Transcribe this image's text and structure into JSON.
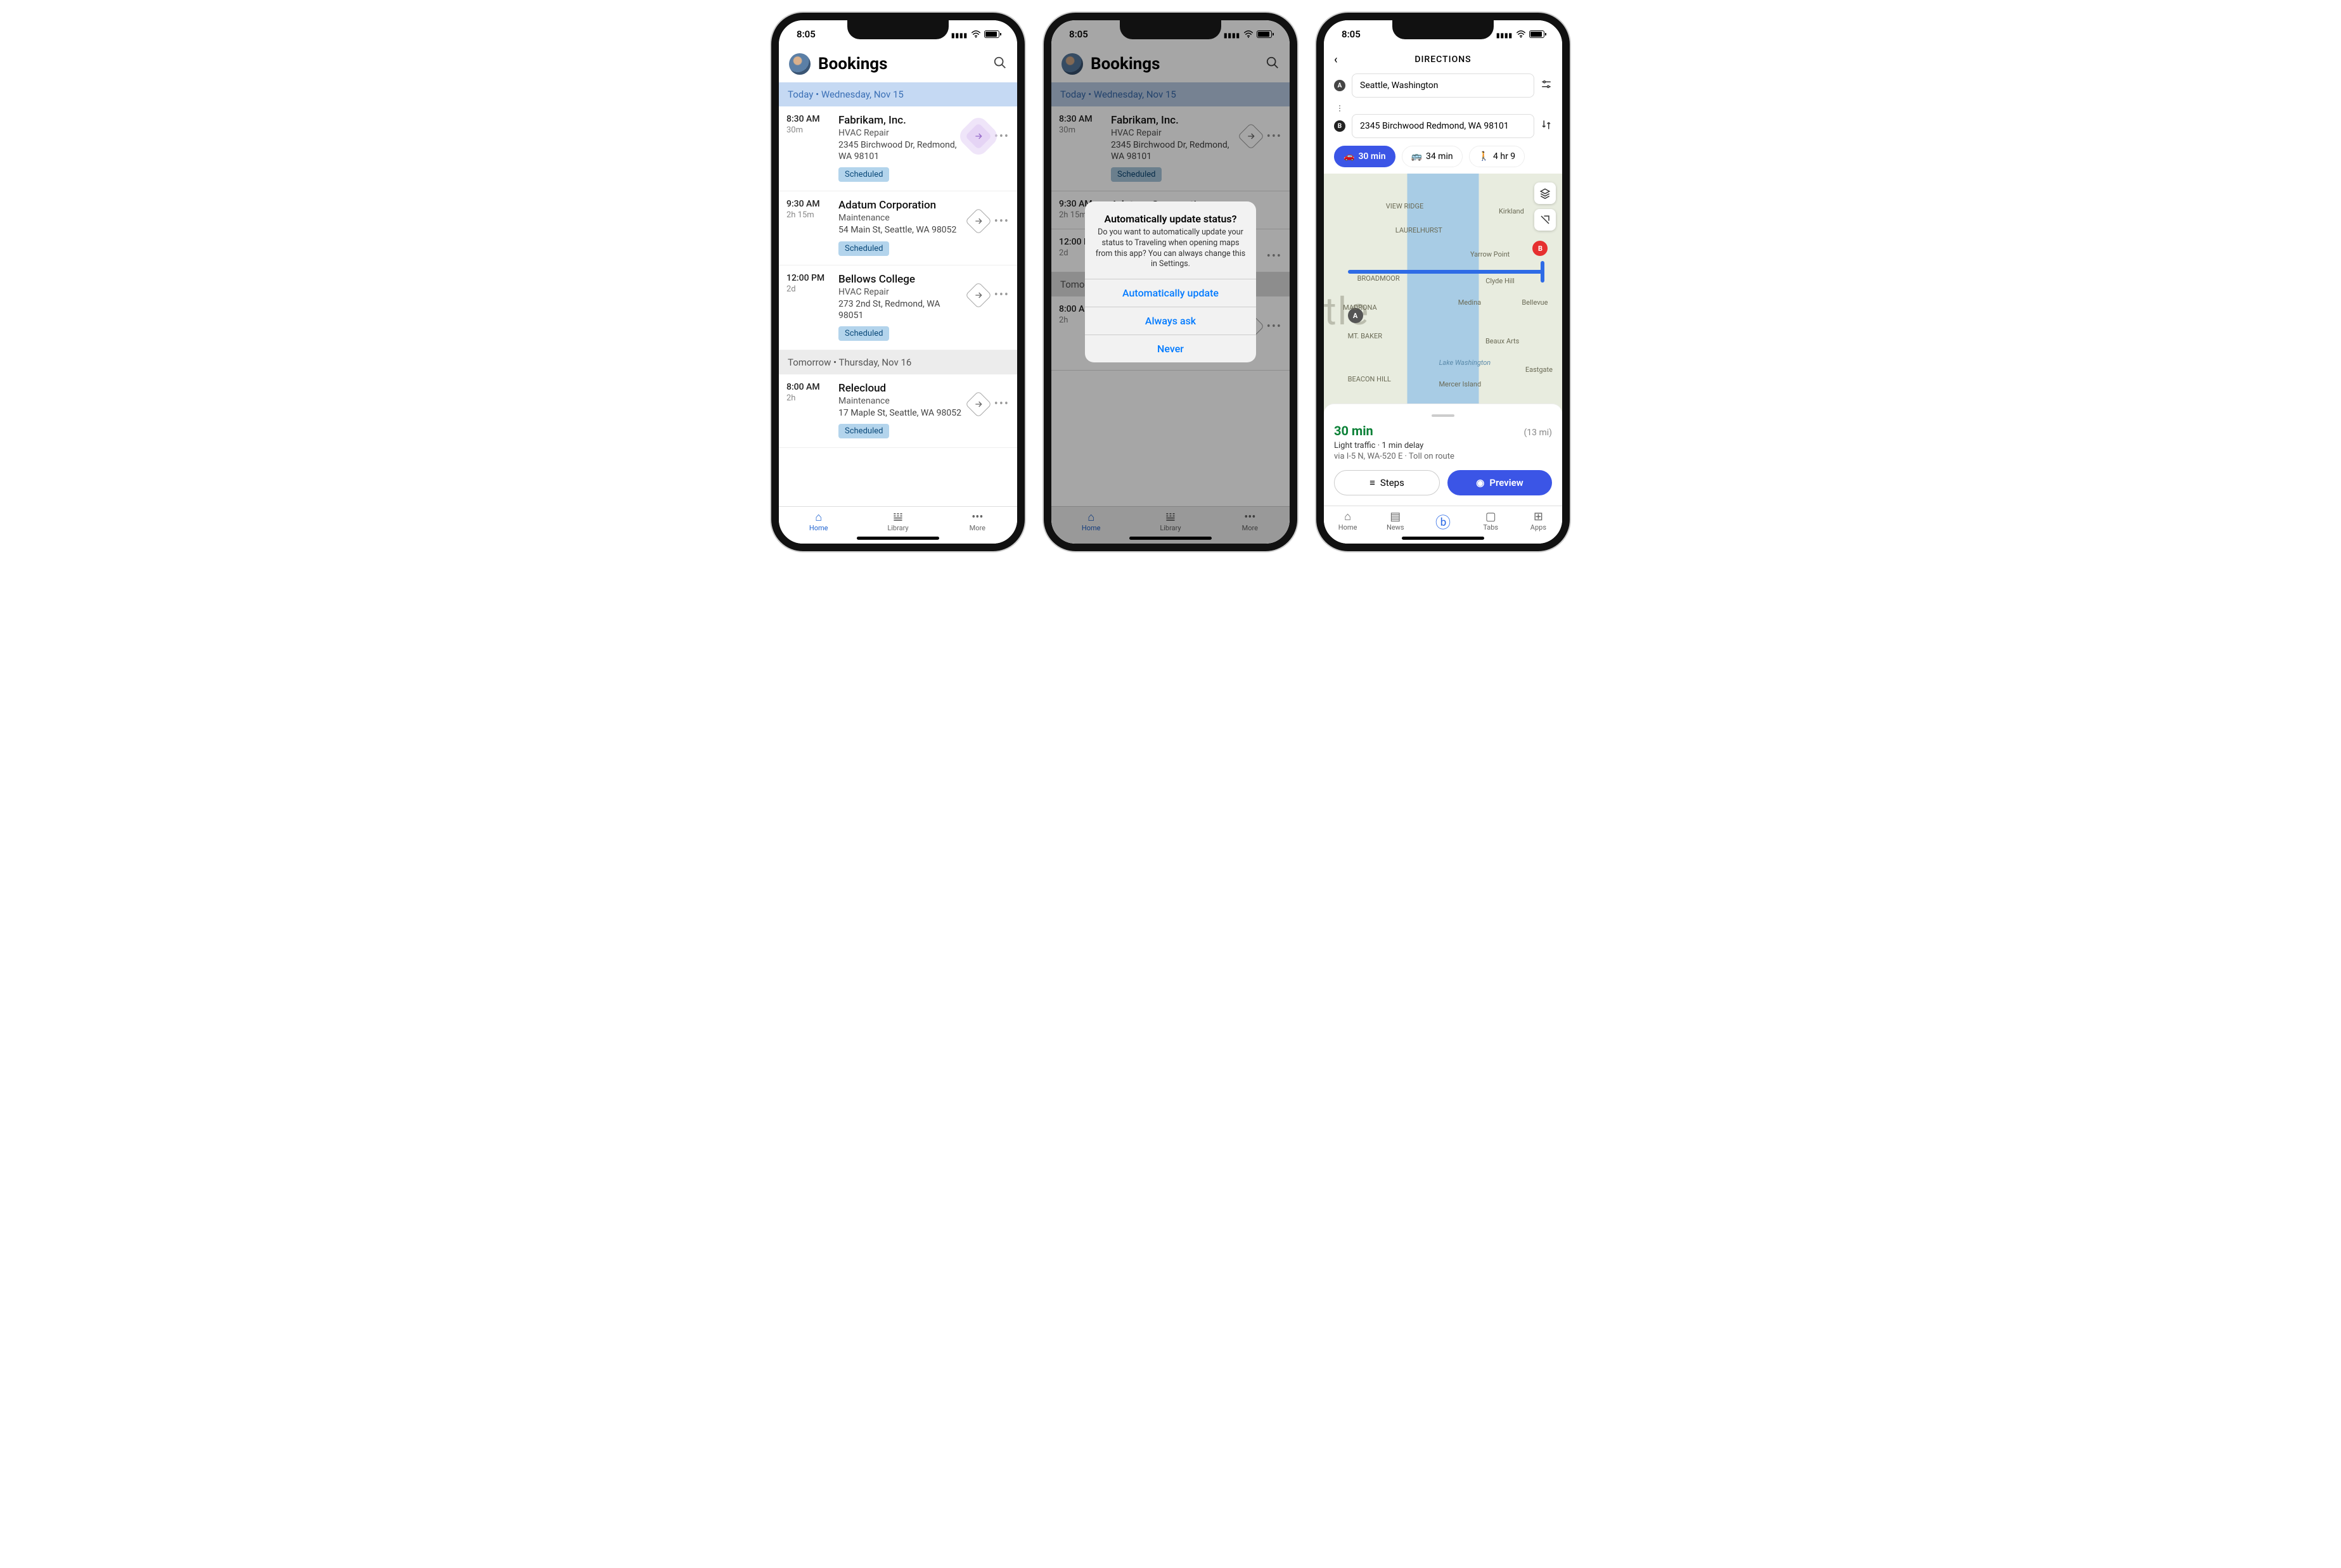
{
  "status": {
    "time": "8:05"
  },
  "app": {
    "title": "Bookings",
    "avatar_label": "User avatar",
    "tabs": {
      "home": "Home",
      "library": "Library",
      "more": "More"
    }
  },
  "sections": {
    "today": "Today  •  Wednesday, Nov 15",
    "tomorrow": "Tomorrow  •  Thursday, Nov 16"
  },
  "bookings": [
    {
      "time": "8:30 AM",
      "dur": "30m",
      "name": "Fabrikam, Inc.",
      "svc": "HVAC Repair",
      "addr": "2345 Birchwood Dr, Redmond, WA 98101",
      "status": "Scheduled",
      "highlight": true
    },
    {
      "time": "9:30 AM",
      "dur": "2h 15m",
      "name": "Adatum Corporation",
      "svc": "Maintenance",
      "addr": "54 Main St, Seattle, WA 98052",
      "status": "Scheduled"
    },
    {
      "time": "12:00 PM",
      "dur": "2d",
      "name": "Bellows College",
      "svc": "HVAC Repair",
      "addr": "273 2nd St, Redmond, WA 98051",
      "status": "Scheduled"
    }
  ],
  "bookings_tomorrow": [
    {
      "time": "8:00 AM",
      "dur": "2h",
      "name": "Relecloud",
      "svc": "Maintenance",
      "addr": "17 Maple St, Seattle, WA 98052",
      "status": "Scheduled"
    }
  ],
  "alert": {
    "title": "Automatically update status?",
    "message": "Do you want to automatically update your status to Traveling when opening maps from this app? You can always change this in Settings.",
    "opts": [
      "Automatically update",
      "Always ask",
      "Never"
    ]
  },
  "directions": {
    "header": "DIRECTIONS",
    "from": "Seattle, Washington",
    "to": "2345 Birchwood Redmond, WA 98101",
    "modes": {
      "car": "30 min",
      "transit": "34 min",
      "walk": "4 hr 9"
    },
    "map_labels": [
      "VIEW RIDGE",
      "Kirkland",
      "LAURELHURST",
      "Yarrow Point",
      "BROADMOOR",
      "Clyde Hill",
      "MADRONA",
      "Medina",
      "Bellevue",
      "MT. BAKER",
      "Beaux Arts",
      "Lake Washington",
      "BEACON HILL",
      "Mercer Island",
      "Eastgate"
    ],
    "summary": {
      "time": "30 min",
      "dist": "(13 mi)",
      "traffic": "Light traffic · 1 min delay",
      "via": "via I-5 N, WA-520 E · Toll on route"
    },
    "btn_steps": "Steps",
    "btn_preview": "Preview",
    "tabs": {
      "home": "Home",
      "news": "News",
      "tabs": "Tabs",
      "apps": "Apps"
    }
  }
}
